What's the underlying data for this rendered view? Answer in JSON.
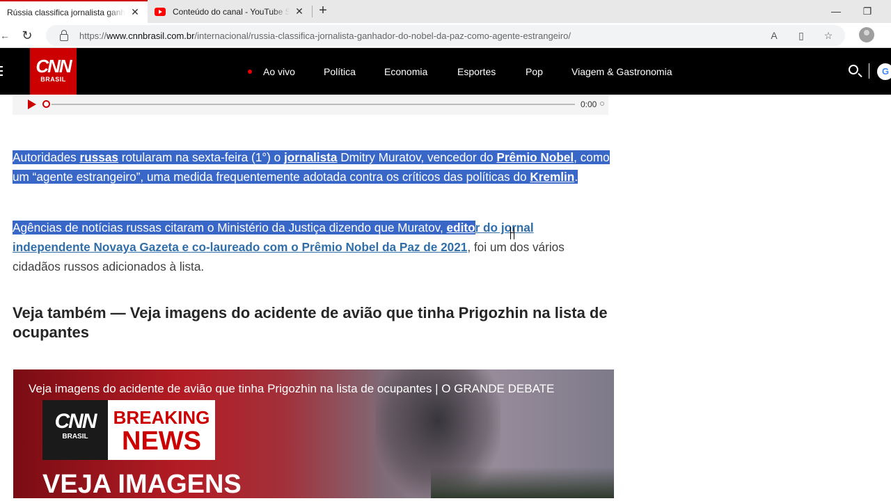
{
  "browser": {
    "tabs": [
      {
        "title": "Rússia classifica jornalista ganhador do Nobel da Paz como agente estrangeiro",
        "active": true
      },
      {
        "title": "Conteúdo do canal - YouTube Studio",
        "active": false
      }
    ],
    "url": {
      "scheme": "https://",
      "host": "www.cnnbrasil.com.br",
      "path": "/internacional/russia-classifica-jornalista-ganhador-do-nobel-da-paz-como-agente-estrangeiro/"
    },
    "window_buttons": {
      "minimize": "—",
      "restore": "❐"
    }
  },
  "site": {
    "logo": {
      "line1": "CNN",
      "line2": "BRASIL"
    },
    "nav": [
      "Ao vivo",
      "Política",
      "Economia",
      "Esportes",
      "Pop",
      "Viagem & Gastronomia"
    ],
    "google_letter": "G"
  },
  "audio": {
    "time": "0:00"
  },
  "article": {
    "p1": {
      "t1": "Autoridades ",
      "l1": "russas",
      "t2": " rotularam na sexta-feira (1°) o ",
      "l2": "jornalista",
      "t3": " Dmitry Muratov, vencedor do ",
      "l3": "Prêmio Nobel",
      "t4": ", como um “agente estrangeiro”, uma medida frequentemente adotada contra os críticos das políticas do ",
      "l4": "Kremlin",
      "t5": "."
    },
    "p2": {
      "t1": "Agências de notícias russas citaram o Ministério da Justiça dizendo que Muratov, ",
      "l1a": "edito",
      "l1b": "r do jornal independente Novaya Gazeta e co-laureado com o Prêmio Nobel da Paz de 2021",
      "t2": ", foi um dos vários cidadãos russos adicionados à lista."
    },
    "see_also": "Veja também — Veja imagens do acidente de avião que tinha Prigozhin na lista de ocupantes"
  },
  "video": {
    "title": "Veja imagens do acidente de avião que tinha Prigozhin na lista de ocupantes | O GRANDE DEBATE",
    "logo": {
      "line1": "CNN",
      "line2": "BRASIL"
    },
    "breaking": {
      "line1": "BREAKING",
      "line2": "NEWS"
    },
    "bottom": "VEJA IMAGENS"
  },
  "colors": {
    "cnn_red": "#cc0000",
    "selection": "#3967c8",
    "link": "#2f6ea8"
  }
}
